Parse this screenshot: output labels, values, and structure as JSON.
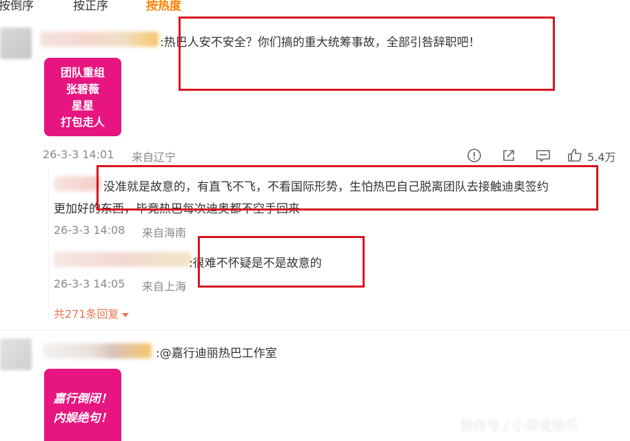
{
  "sort_tabs": [
    {
      "label": "按倒序"
    },
    {
      "label": "按正序"
    },
    {
      "label": "按热度"
    }
  ],
  "comments": [
    {
      "text": ":热巴人安不安全？你们搞的重大统筹事故，全部引咎辞职吧！",
      "sticker_lines": [
        "团队重组",
        "张碧薇",
        "星星",
        "打包走人"
      ],
      "time": "26-3-3 14:01",
      "location": "来自辽宁",
      "likes": "5.4万",
      "actions": {
        "share_icon": "share-icon",
        "comment_icon": "comment-icon",
        "like_icon": "thumbs-up-icon",
        "report_icon": "report-icon"
      },
      "replies": [
        {
          "line1": "没准就是故意的，有直飞不飞，不看国际形势，生怕热巴自己脱离团队去接触迪奥签约",
          "line2": "更加好的东西，毕竟热巴每次迪奥都不空手回来",
          "time": "26-3-3 14:08",
          "location": "来自海南"
        },
        {
          "line1": ":很难不怀疑是不是故意的",
          "time": "26-3-3 14:05",
          "location": "来自上海"
        }
      ],
      "more_replies": "共271条回复"
    },
    {
      "text": ":@嘉行迪丽热巴工作室",
      "sticker_lines": [
        "嘉行倒闭！",
        "内娱绝句！"
      ]
    }
  ],
  "watermark": "快传号 / 小郑说娱乐",
  "colors": {
    "accent": "#ff8200",
    "highlight_box": "#d9121e",
    "sticker_bg": "#e6157f",
    "link": "#eb7350"
  }
}
